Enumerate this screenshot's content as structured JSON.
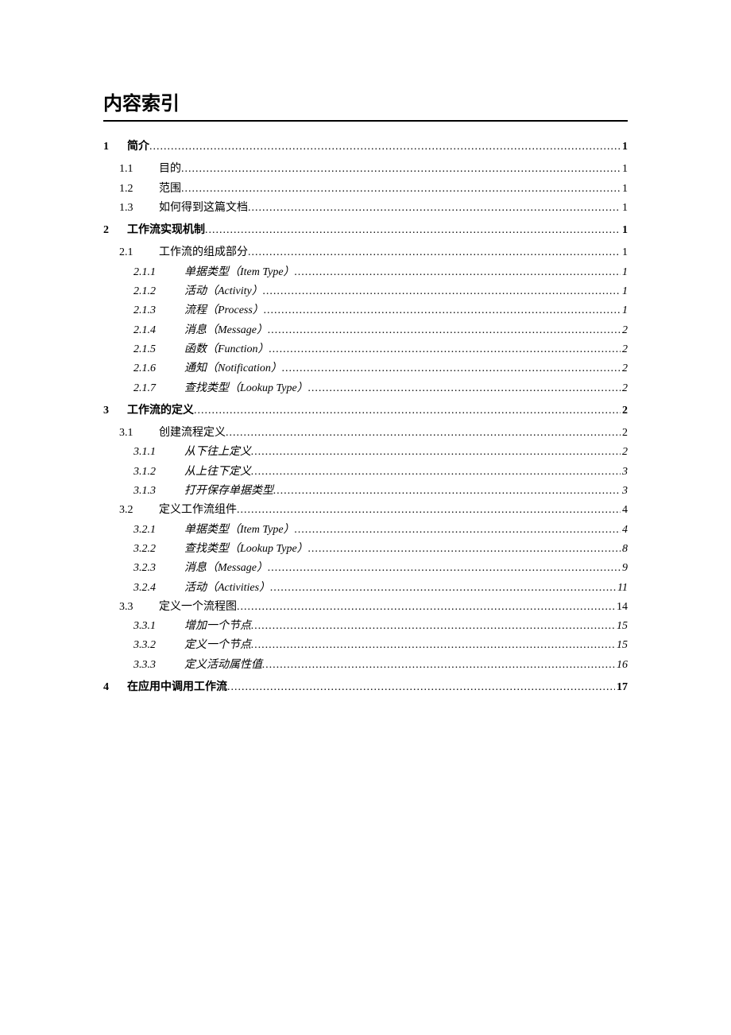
{
  "title": "内容索引",
  "toc": [
    {
      "level": 1,
      "num": "1",
      "label": "简介",
      "page": "1"
    },
    {
      "level": 2,
      "num": "1.1",
      "label": "目的",
      "page": "1"
    },
    {
      "level": 2,
      "num": "1.2",
      "label": "范围",
      "page": "1"
    },
    {
      "level": 2,
      "num": "1.3",
      "label": "如何得到这篇文档",
      "page": "1"
    },
    {
      "level": 1,
      "num": "2",
      "label": "工作流实现机制",
      "page": "1"
    },
    {
      "level": 2,
      "num": "2.1",
      "label": "工作流的组成部分",
      "page": "1"
    },
    {
      "level": 3,
      "num": "2.1.1",
      "label": "单据类型（Item Type）",
      "page": "1"
    },
    {
      "level": 3,
      "num": "2.1.2",
      "label": "活动（Activity）",
      "page": "1"
    },
    {
      "level": 3,
      "num": "2.1.3",
      "label": "流程（Process）",
      "page": "1"
    },
    {
      "level": 3,
      "num": "2.1.4",
      "label": "消息（Message）",
      "page": "2"
    },
    {
      "level": 3,
      "num": "2.1.5",
      "label": "函数（Function）",
      "page": "2"
    },
    {
      "level": 3,
      "num": "2.1.6",
      "label": "通知（Notification）",
      "page": "2"
    },
    {
      "level": 3,
      "num": "2.1.7",
      "label": "查找类型（Lookup Type）",
      "page": "2"
    },
    {
      "level": 1,
      "num": "3",
      "label": "工作流的定义",
      "page": "2"
    },
    {
      "level": 2,
      "num": "3.1",
      "label": "创建流程定义",
      "page": "2"
    },
    {
      "level": 3,
      "num": "3.1.1",
      "label": "从下往上定义",
      "page": "2"
    },
    {
      "level": 3,
      "num": "3.1.2",
      "label": "从上往下定义",
      "page": "3"
    },
    {
      "level": 3,
      "num": "3.1.3",
      "label": "打开保存单据类型",
      "page": "3"
    },
    {
      "level": 2,
      "num": "3.2",
      "label": "定义工作流组件",
      "page": "4"
    },
    {
      "level": 3,
      "num": "3.2.1",
      "label": "单据类型（Item Type）",
      "page": "4"
    },
    {
      "level": 3,
      "num": "3.2.2",
      "label": "查找类型（Lookup Type）",
      "page": "8"
    },
    {
      "level": 3,
      "num": "3.2.3",
      "label": "消息（Message）",
      "page": "9"
    },
    {
      "level": 3,
      "num": "3.2.4",
      "label": "活动（Activities）",
      "page": "11"
    },
    {
      "level": 2,
      "num": "3.3",
      "label": "定义一个流程图",
      "page": "14"
    },
    {
      "level": 3,
      "num": "3.3.1",
      "label": "增加一个节点",
      "page": "15"
    },
    {
      "level": 3,
      "num": "3.3.2",
      "label": "定义一个节点",
      "page": "15"
    },
    {
      "level": 3,
      "num": "3.3.3",
      "label": "定义活动属性值",
      "page": "16"
    },
    {
      "level": 1,
      "num": "4",
      "label": "在应用中调用工作流",
      "page": "17"
    }
  ]
}
